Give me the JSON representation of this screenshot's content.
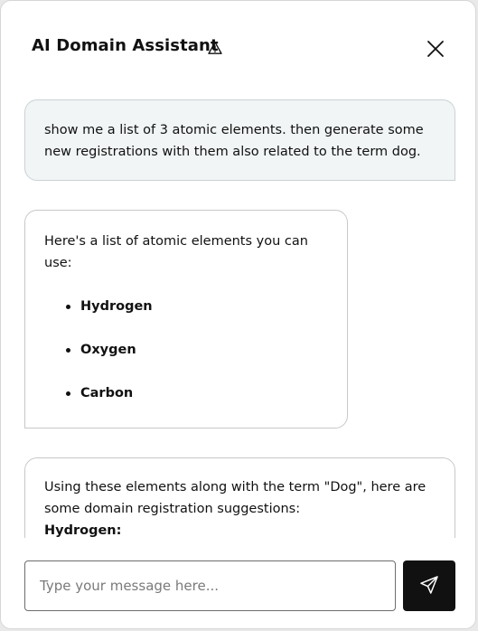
{
  "header": {
    "title": "AI Domain Assistant",
    "warning_icon": "warning-triangle-icon",
    "close_icon": "close-icon"
  },
  "messages": {
    "user": {
      "line1": "show me a list of 3 atomic elements. then generate some",
      "line2": "new registrations with them also related to the term dog."
    },
    "assistant_1": {
      "intro": "Here's a list of atomic elements you can use:",
      "items": [
        "Hydrogen",
        "Oxygen",
        "Carbon"
      ]
    },
    "assistant_2": {
      "line1": "Using these elements along with the term \"Dog\", here are",
      "line2": "some domain registration suggestions:",
      "subheading": "Hydrogen:"
    }
  },
  "composer": {
    "placeholder": "Type your message here...",
    "value": "",
    "send_icon": "send-icon"
  },
  "colors": {
    "user_bubble_bg": "#f1f5f6",
    "send_button_bg": "#111111"
  }
}
